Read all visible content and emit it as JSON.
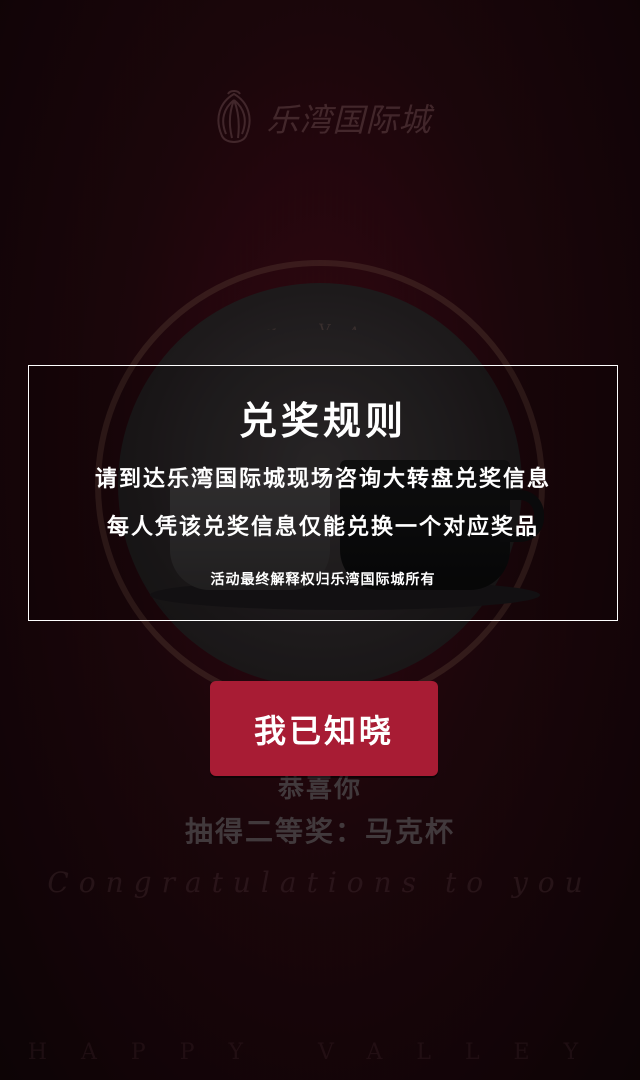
{
  "colors": {
    "background": "#2d0a12",
    "accent_button": "#a81c34",
    "modal_border": "#ffffff",
    "text": "#ffffff"
  },
  "logo": {
    "icon": "shell-logo-icon",
    "text": "乐湾国际城"
  },
  "ring": {
    "text": "HAPPY VALLEY"
  },
  "modal": {
    "title": "兑奖规则",
    "line1": "请到达乐湾国际城现场咨询大转盘兑奖信息",
    "line2": "每人凭该兑奖信息仅能兑换一个对应奖品",
    "note": "活动最终解释权归乐湾国际城所有",
    "button_label": "我已知晓"
  },
  "background": {
    "congrats_title": "恭喜你",
    "congrats_prize": "抽得二等奖：马克杯",
    "congrats_script": "Congratulations to you",
    "footer_text": "HAPPY VALLEY"
  }
}
